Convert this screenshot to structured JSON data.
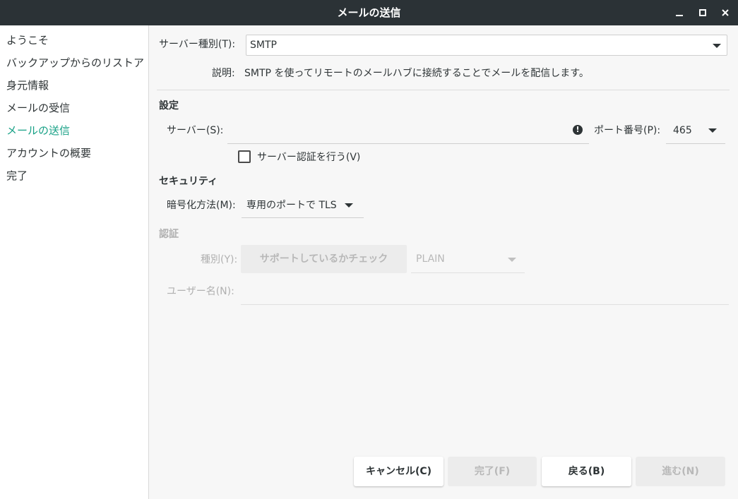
{
  "window": {
    "title": "メールの送信",
    "controls": {
      "minimize_icon": "minimize-icon",
      "maximize_icon": "maximize-icon",
      "close_icon": "close-icon"
    }
  },
  "sidebar": {
    "items": [
      {
        "label": "ようこそ",
        "active": false
      },
      {
        "label": "バックアップからのリストア",
        "active": false
      },
      {
        "label": "身元情報",
        "active": false
      },
      {
        "label": "メールの受信",
        "active": false
      },
      {
        "label": "メールの送信",
        "active": true
      },
      {
        "label": "アカウントの概要",
        "active": false
      },
      {
        "label": "完了",
        "active": false
      }
    ],
    "active_color": "#16a085"
  },
  "server_type": {
    "label": "サーバー種別(T):",
    "value": "SMTP"
  },
  "description": {
    "label": "説明:",
    "text": "SMTP を使ってリモートのメールハブに接続することでメールを配信します。"
  },
  "settings": {
    "title": "設定",
    "server_label": "サーバー(S):",
    "server_value": "",
    "warning_icon": "exclamation-icon",
    "port_label": "ポート番号(P):",
    "port_value": "465",
    "auth_checkbox_label": "サーバー認証を行う(V)",
    "auth_checked": false
  },
  "security": {
    "title": "セキュリティ",
    "encryption_label": "暗号化方法(M):",
    "encryption_value": "専用のポートで TLS"
  },
  "authentication": {
    "title": "認証",
    "type_label": "種別(Y):",
    "check_supported_button": "サポートしているかチェック",
    "type_value": "PLAIN",
    "username_label": "ユーザー名(N):",
    "username_value": ""
  },
  "footer": {
    "cancel": "キャンセル(C)",
    "finish": "完了(F)",
    "back": "戻る(B)",
    "next": "進む(N)"
  }
}
